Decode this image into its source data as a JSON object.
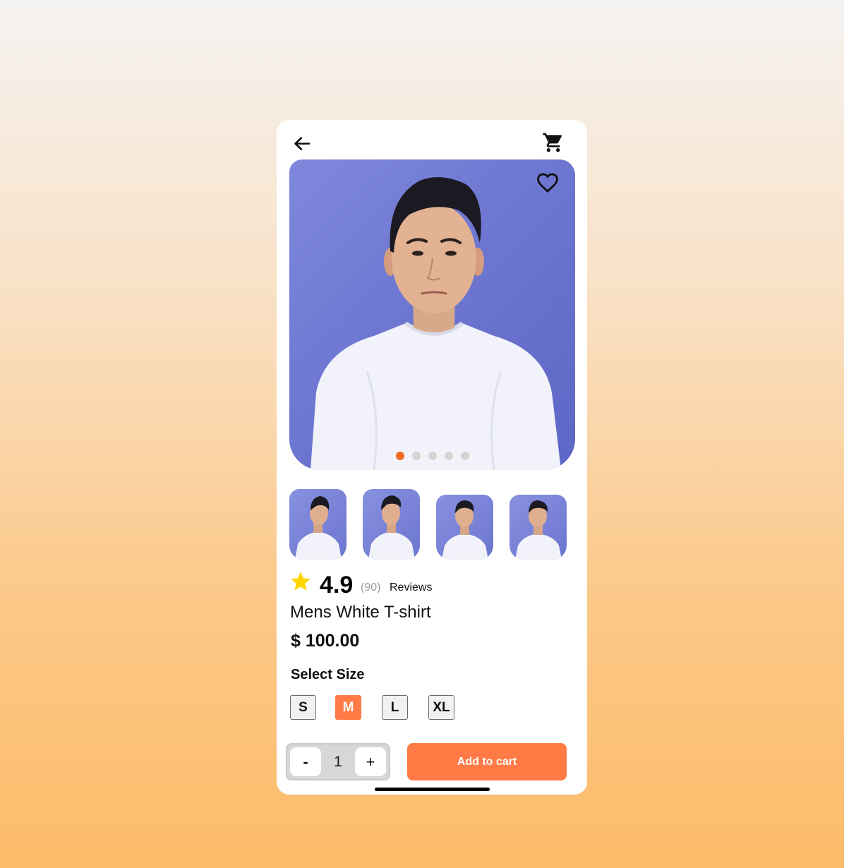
{
  "header": {
    "back_icon": "arrow-left-icon",
    "cart_icon": "shopping-cart-icon"
  },
  "gallery": {
    "favorite_icon": "heart-outline-icon",
    "image_count": 5,
    "active_index": 0,
    "thumbnail_count": 4,
    "hero_background": "#6f79d2",
    "active_dot_color": "#f26a22"
  },
  "rating": {
    "star_icon": "star-icon",
    "score": "4.9",
    "count": "(90)",
    "reviews_label": "Reviews"
  },
  "product": {
    "name": "Mens White T-shirt",
    "price": "$ 100.00"
  },
  "sizes": {
    "label": "Select Size",
    "options": [
      "S",
      "M",
      "L",
      "XL"
    ],
    "selected": "M"
  },
  "quantity": {
    "minus_label": "-",
    "value": "1",
    "plus_label": "+"
  },
  "actions": {
    "add_to_cart": "Add to cart"
  },
  "colors": {
    "accent": "#ff7a45",
    "star": "#ffd600"
  }
}
